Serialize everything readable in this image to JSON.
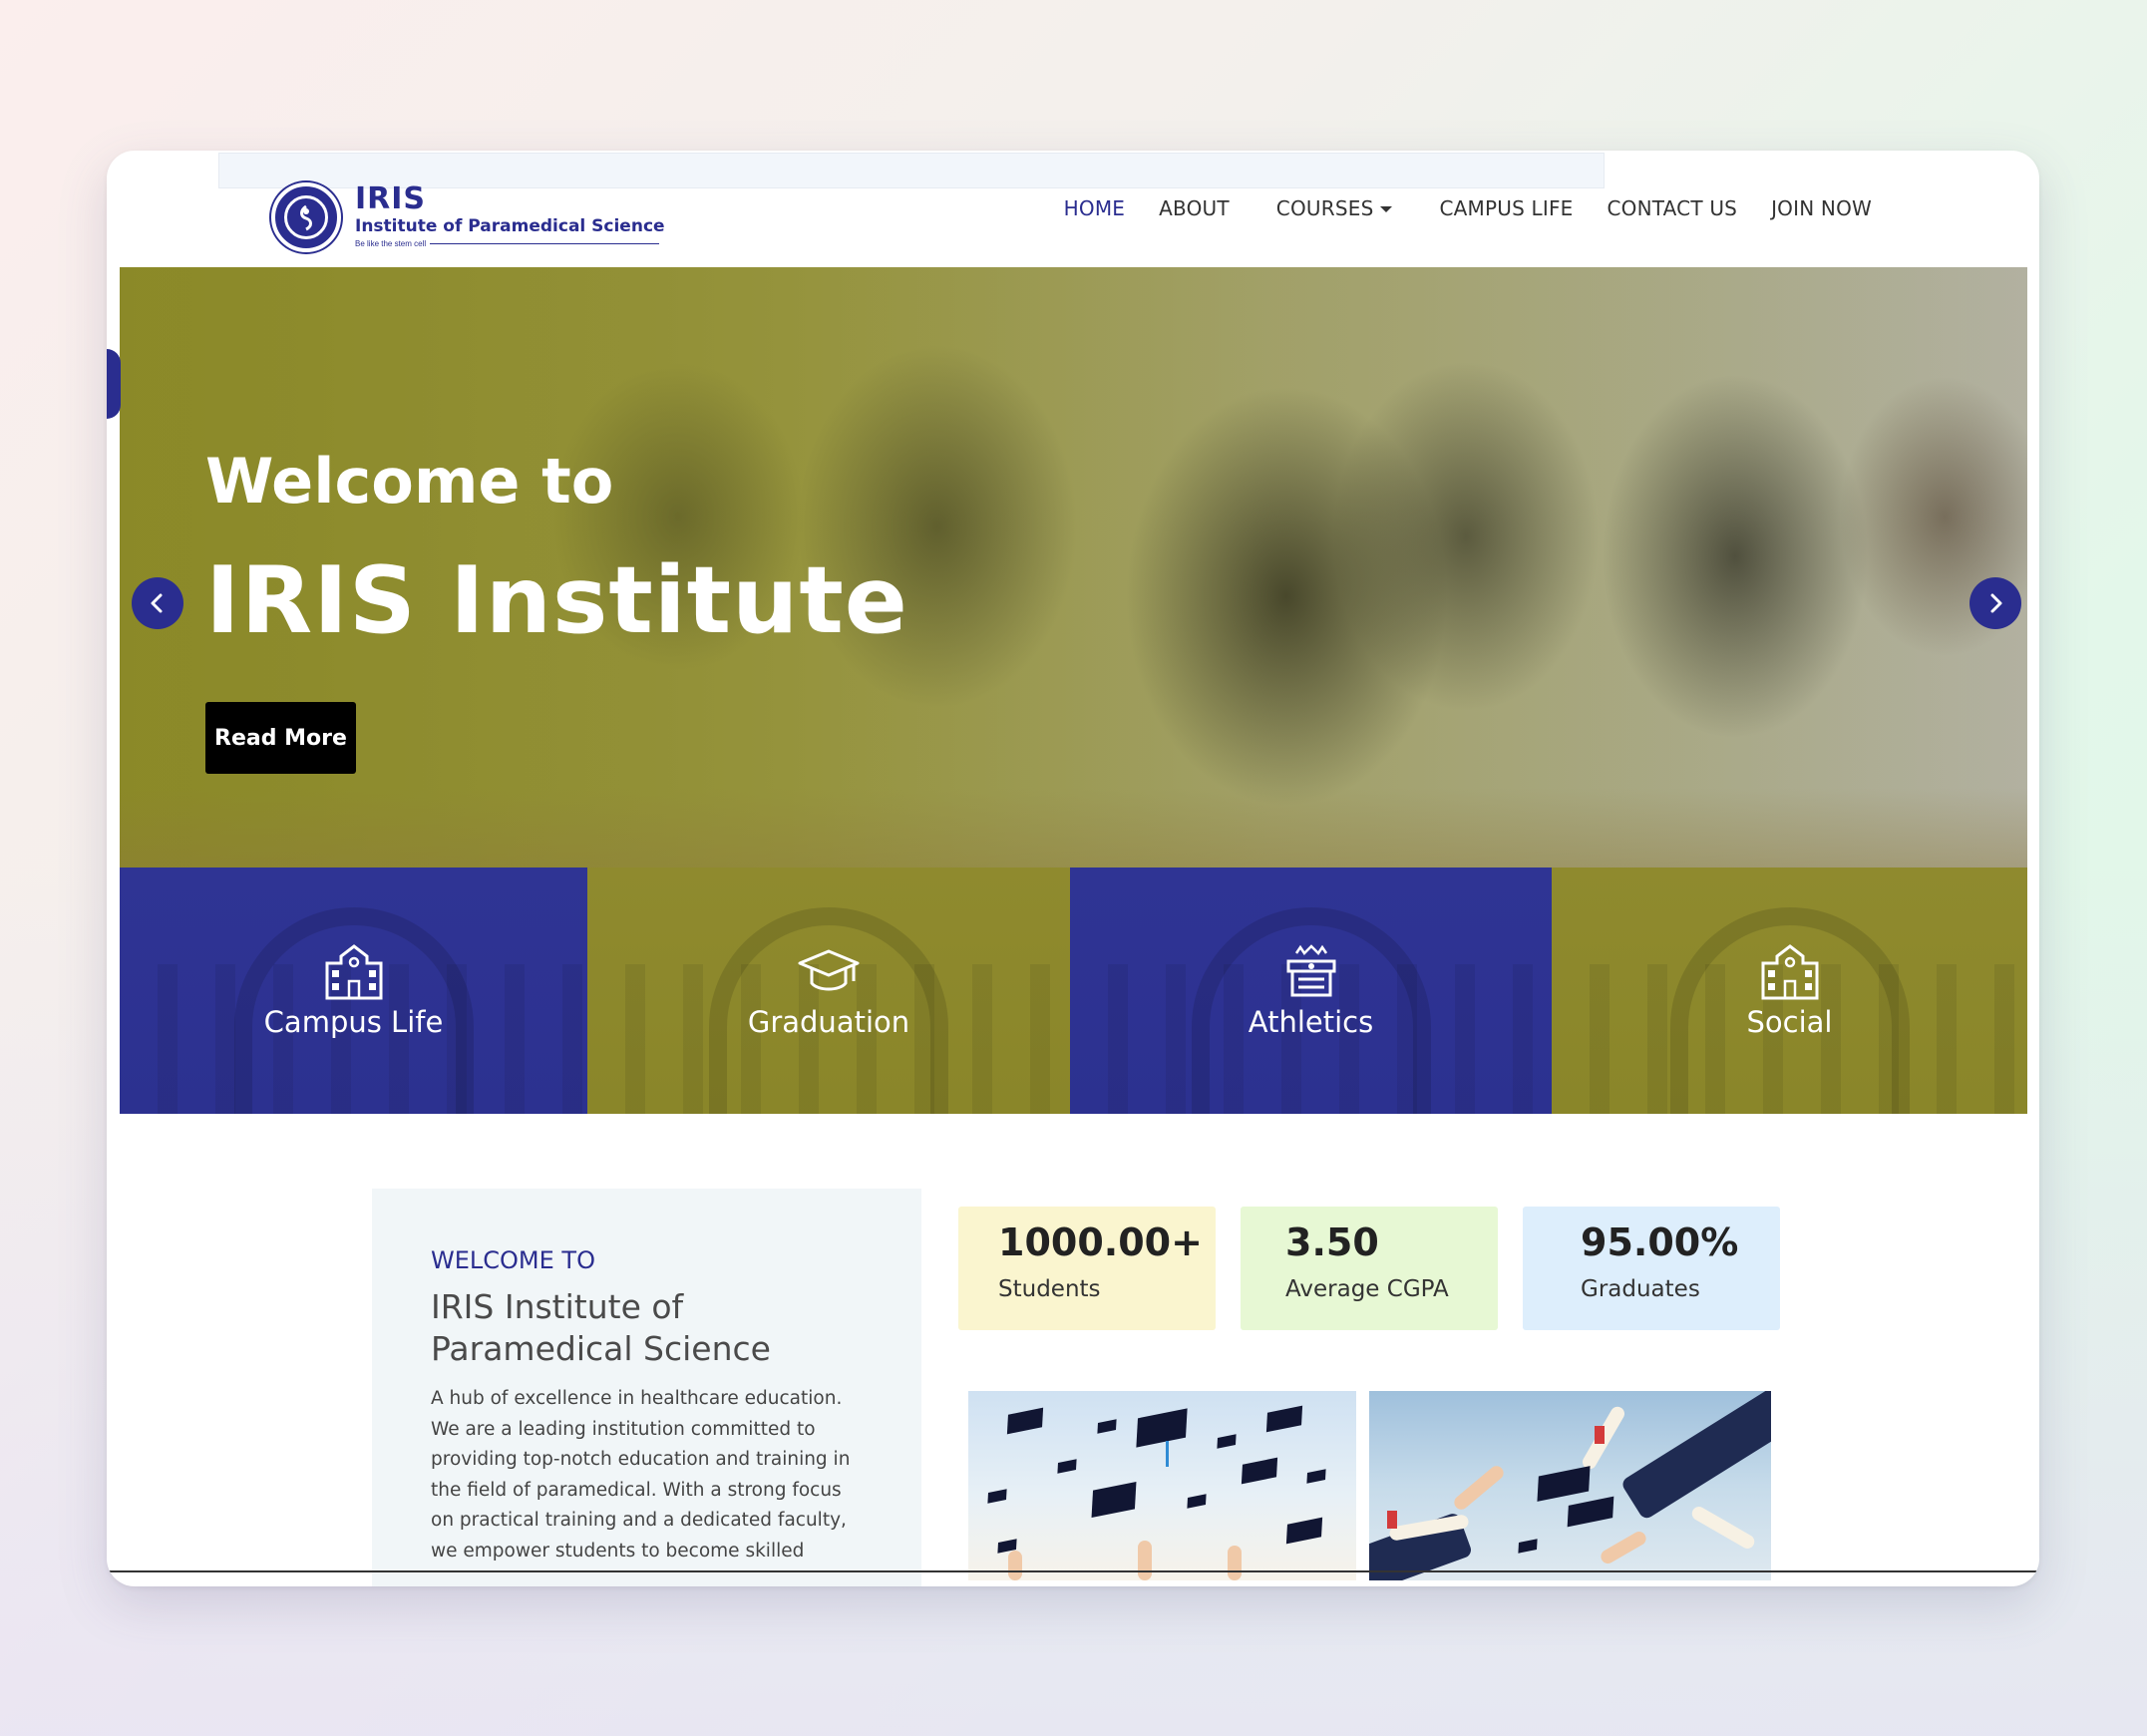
{
  "header": {
    "logo": {
      "title": "IRIS",
      "subtitle": "Institute of Paramedical Science",
      "tagline": "Be like the stem cell"
    },
    "nav": [
      {
        "label": "HOME",
        "active": true
      },
      {
        "label": "ABOUT"
      },
      {
        "label": "COURSES",
        "has_dropdown": true
      },
      {
        "label": "CAMPUS LIFE"
      },
      {
        "label": "CONTACT US"
      },
      {
        "label": "JOIN NOW"
      }
    ]
  },
  "hero": {
    "welcome": "Welcome to",
    "title": "IRIS Institute",
    "button_label": "Read More",
    "prev_icon": "chevron-left-icon",
    "next_icon": "chevron-right-icon"
  },
  "tiles": [
    {
      "label": "Campus Life",
      "icon": "school-building-icon",
      "color": "#2f3494"
    },
    {
      "label": "Graduation",
      "icon": "graduation-cap-icon",
      "color": "#8f8a2e"
    },
    {
      "label": "Athletics",
      "icon": "stadium-icon",
      "color": "#2f3494"
    },
    {
      "label": "Social",
      "icon": "school-building-icon",
      "color": "#8f8a2e"
    }
  ],
  "about": {
    "kicker": "WELCOME TO",
    "title": "IRIS Institute of Paramedical Science",
    "body": "A hub of excellence in healthcare education. We are a leading institution committed to providing top-notch education and training in the field of paramedical. With a strong focus on practical training and a dedicated faculty, we empower students to become skilled"
  },
  "stats": [
    {
      "value": "1000.00+",
      "label": "Students",
      "color": "#faf5cf"
    },
    {
      "value": "3.50",
      "label": "Average CGPA",
      "color": "#e7f8d4"
    },
    {
      "value": "95.00%",
      "label": "Graduates",
      "color": "#ddeefc"
    }
  ],
  "colors": {
    "brand": "#2a2d8f",
    "olive": "#8f8a2e",
    "button": "#000000"
  }
}
